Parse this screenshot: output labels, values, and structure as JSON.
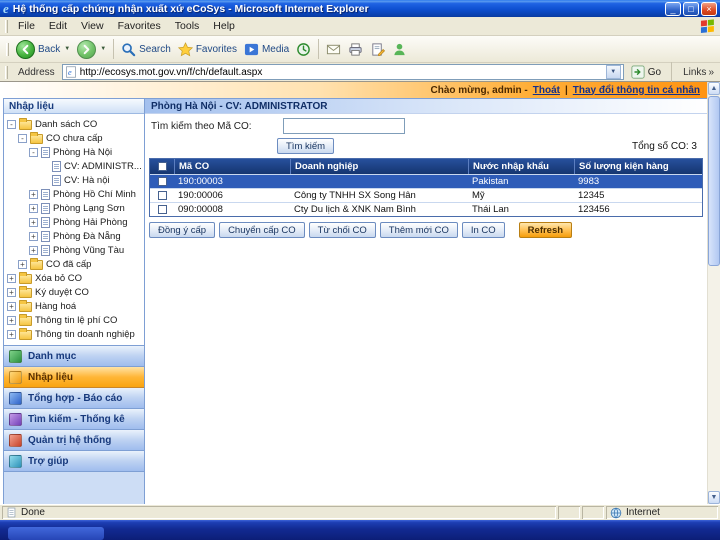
{
  "window": {
    "title": "Hệ thống cấp chứng nhận xuất xứ eCoSys - Microsoft Internet Explorer"
  },
  "menu": {
    "items": [
      "File",
      "Edit",
      "View",
      "Favorites",
      "Tools",
      "Help"
    ]
  },
  "toolbar": {
    "back_label": "Back",
    "search_label": "Search",
    "favorites_label": "Favorites",
    "media_label": "Media"
  },
  "address": {
    "label": "Address",
    "url": "http://ecosys.mot.gov.vn/f/ch/default.aspx",
    "go_label": "Go",
    "links_label": "Links"
  },
  "greeting": {
    "welcome": "Chào mừng, admin -",
    "logout_link": "Thoát",
    "divider": "|",
    "profile_link": "Thay đổi thông tin cá nhân"
  },
  "sidebar": {
    "panel_title": "Nhập liệu",
    "tree": [
      {
        "label": "Danh sách CO",
        "level": 0,
        "expander": "-",
        "icon": "folder"
      },
      {
        "label": "CO chưa cấp",
        "level": 1,
        "expander": "-",
        "icon": "folder"
      },
      {
        "label": "Phòng Hà Nội",
        "level": 2,
        "expander": "-",
        "icon": "doc"
      },
      {
        "label": "CV: ADMINISTR...",
        "level": 3,
        "expander": "",
        "icon": "doc"
      },
      {
        "label": "CV: Hà nội",
        "level": 3,
        "expander": "",
        "icon": "doc"
      },
      {
        "label": "Phòng Hồ Chí Minh",
        "level": 2,
        "expander": "+",
        "icon": "doc"
      },
      {
        "label": "Phòng Lạng Sơn",
        "level": 2,
        "expander": "+",
        "icon": "doc"
      },
      {
        "label": "Phòng Hải Phòng",
        "level": 2,
        "expander": "+",
        "icon": "doc"
      },
      {
        "label": "Phòng Đà Nẵng",
        "level": 2,
        "expander": "+",
        "icon": "doc"
      },
      {
        "label": "Phòng Vũng Tàu",
        "level": 2,
        "expander": "+",
        "icon": "doc"
      },
      {
        "label": "CO đã cấp",
        "level": 1,
        "expander": "+",
        "icon": "folder"
      },
      {
        "label": "Xóa bỏ CO",
        "level": 0,
        "expander": "+",
        "icon": "folder"
      },
      {
        "label": "Ký duyệt CO",
        "level": 0,
        "expander": "+",
        "icon": "folder"
      },
      {
        "label": "Hàng hoá",
        "level": 0,
        "expander": "+",
        "icon": "folder"
      },
      {
        "label": "Thông tin lệ phí CO",
        "level": 0,
        "expander": "+",
        "icon": "folder"
      },
      {
        "label": "Thông tin doanh nghiệp",
        "level": 0,
        "expander": "+",
        "icon": "folder"
      }
    ],
    "accordion": [
      {
        "label": "Danh mục",
        "active": false,
        "icon": "catalog-icon"
      },
      {
        "label": "Nhập liệu",
        "active": true,
        "icon": "data-entry-icon"
      },
      {
        "label": "Tổng hợp - Báo cáo",
        "active": false,
        "icon": "report-icon"
      },
      {
        "label": "Tìm kiếm - Thống kê",
        "active": false,
        "icon": "search-stats-icon"
      },
      {
        "label": "Quản trị hệ thống",
        "active": false,
        "icon": "admin-icon"
      },
      {
        "label": "Trợ giúp",
        "active": false,
        "icon": "help-icon"
      }
    ]
  },
  "main": {
    "header": "Phòng Hà Nội - CV: ADMINISTRATOR",
    "search": {
      "label": "Tìm kiếm theo Mã CO:",
      "value": "",
      "button": "Tìm kiếm"
    },
    "total": "Tổng số CO: 3",
    "table": {
      "columns": [
        "Mã CO",
        "Doanh nghiệp",
        "Nước nhập khẩu",
        "Số lượng kiện hàng"
      ],
      "rows": [
        {
          "cells": [
            "190:00003",
            "",
            "Pakistan",
            "9983"
          ],
          "selected": true,
          "checked": false
        },
        {
          "cells": [
            "190:00006",
            "Công ty TNHH SX Song Hân",
            "Mỹ",
            "12345"
          ],
          "selected": false,
          "checked": false
        },
        {
          "cells": [
            "090:00008",
            "Cty Du lịch & XNK Nam Bình",
            "Thái Lan",
            "123456"
          ],
          "selected": false,
          "checked": false
        }
      ]
    },
    "actions": [
      "Đồng ý cấp",
      "Chuyển cấp CO",
      "Từ chối CO",
      "Thêm mới CO",
      "In CO"
    ],
    "refresh": "Refresh"
  },
  "status": {
    "left": "Done",
    "right": "Internet"
  },
  "colors": {
    "xp_blue": "#0e4fd0",
    "accent_orange": "#ff9413",
    "table_header_navy": "#15356f",
    "selected_row_blue": "#2e5cb8",
    "sidebar_blue": "#cdddf5"
  }
}
